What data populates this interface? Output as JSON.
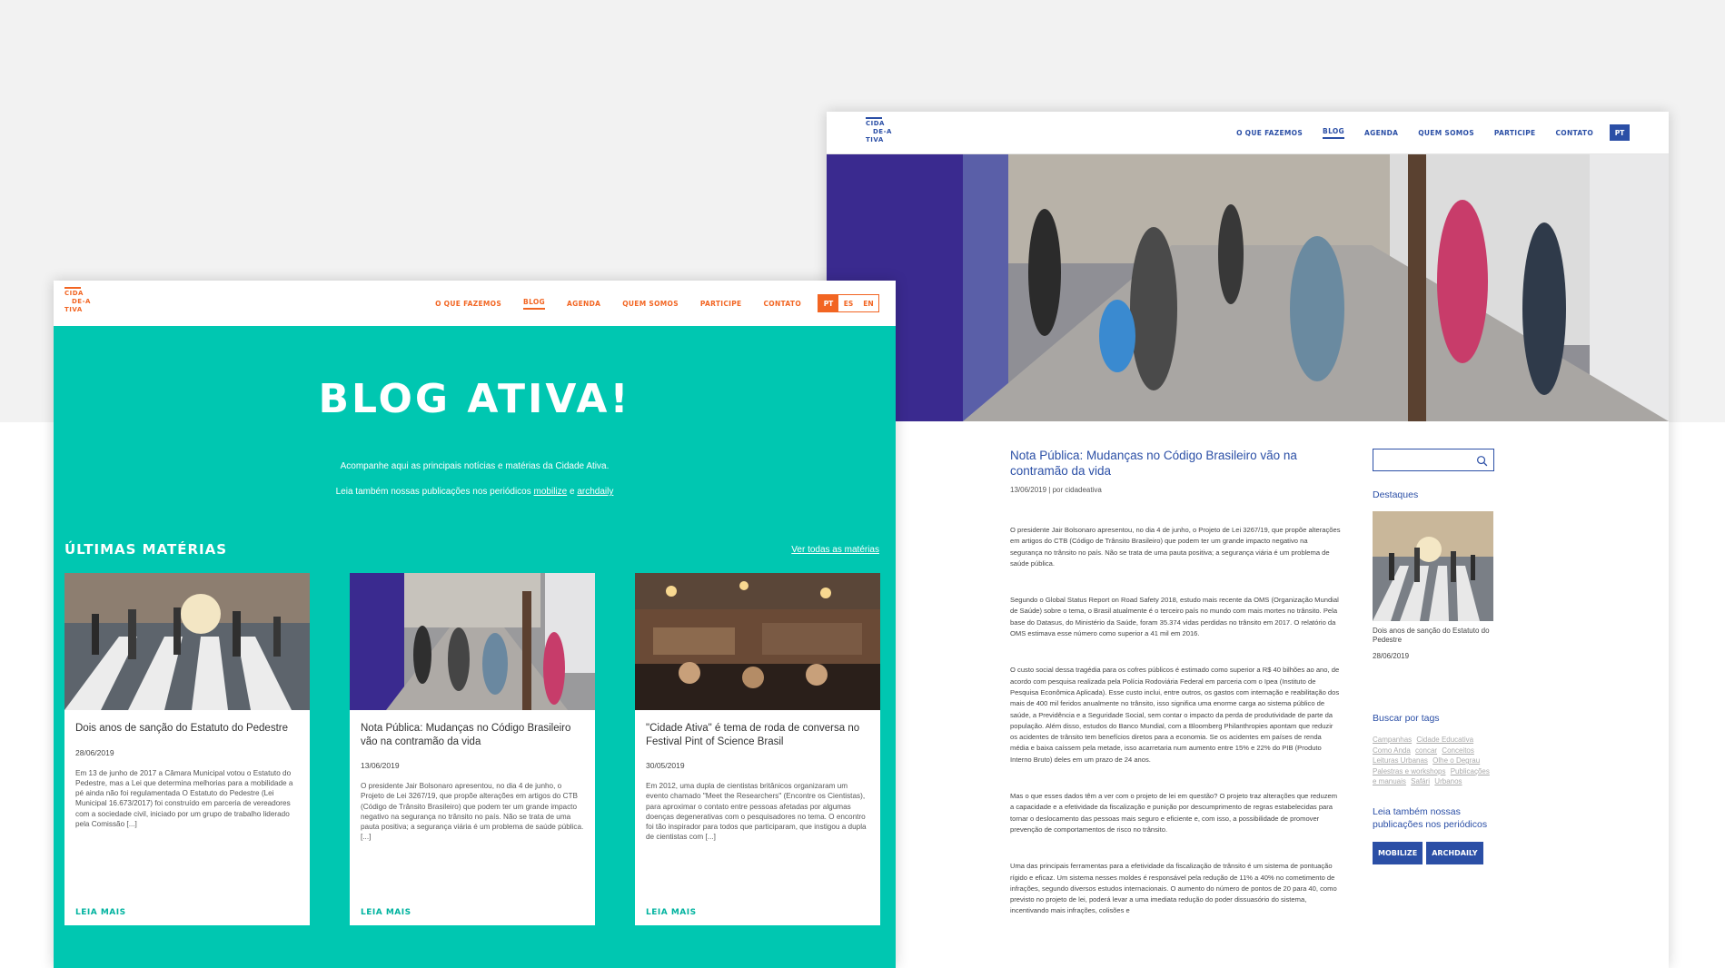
{
  "article_page": {
    "logo": [
      "CIDA",
      "DE-A",
      "TIVA"
    ],
    "nav": [
      "O QUE FAZEMOS",
      "BLOG",
      "AGENDA",
      "QUEM SOMOS",
      "PARTICIPE",
      "CONTATO"
    ],
    "lang": "PT",
    "article": {
      "title": "Nota Pública: Mudanças no Código Brasileiro vão na contramão da vida",
      "meta": "13/06/2019 | por cidadeativa",
      "paragraphs": [
        "O presidente Jair Bolsonaro apresentou, no dia 4 de junho, o Projeto de Lei 3267/19, que propõe alterações em artigos do CTB (Código de Trânsito Brasileiro) que podem ter um grande impacto negativo na segurança no trânsito no país. Não se trata de uma pauta positiva; a segurança viária é um problema de saúde pública.",
        "Segundo o Global Status Report on Road Safety 2018, estudo mais recente da OMS (Organização Mundial de Saúde) sobre o tema, o Brasil atualmente é o terceiro país no mundo com mais mortes no trânsito. Pela base do Datasus, do Ministério da Saúde, foram 35.374 vidas perdidas no trânsito em 2017. O relatório da OMS estimava esse número como superior a 41 mil em 2016.",
        "O custo social dessa tragédia para os cofres públicos é estimado como superior a R$ 40 bilhões ao ano, de acordo com pesquisa realizada pela Polícia Rodoviária Federal em parceria com o Ipea (Instituto de Pesquisa Econômica Aplicada). Esse custo inclui, entre outros, os gastos com internação e reabilitação dos mais de 400 mil feridos anualmente no trânsito, isso significa uma enorme carga ao sistema público de saúde, a Previdência e a Seguridade Social, sem contar o impacto da perda de produtividade de parte da população. Além disso, estudos do Banco Mundial, com a Bloomberg Philanthropies apontam que reduzir os acidentes de trânsito tem benefícios diretos para a economia. Se os acidentes em países de renda média e baixa caíssem pela metade, isso acarretaria num aumento entre 15% e 22% do PIB (Produto Interno Bruto) deles em um prazo de 24 anos.",
        "Mas o que esses dados têm a ver com o projeto de lei em questão? O projeto traz alterações que reduzem a capacidade e a efetividade da fiscalização e punição por descumprimento de regras estabelecidas para tornar o deslocamento das pessoas mais seguro e eficiente e, com isso, a possibilidade de promover prevenção de comportamentos de risco no trânsito.",
        "Uma das principais ferramentas para a efetividade da fiscalização de trânsito é um sistema de pontuação rígido e eficaz. Um sistema nesses moldes é responsável pela redução de 11% a 40% no cometimento de infrações, segundo diversos estudos internacionais. O aumento do número de pontos de 20 para 40, como previsto no projeto de lei, poderá levar a uma imediata redução do poder dissuasório do sistema, incentivando mais infrações, colisões e"
      ]
    },
    "sidebar": {
      "highlights_heading": "Destaques",
      "highlight_caption": "Dois anos de sanção do Estatuto do Pedestre",
      "highlight_date": "28/06/2019",
      "tags_heading": "Buscar por tags",
      "tags": [
        "Campanhas",
        "Cidade Educativa",
        "Como Anda",
        "concar",
        "Conceitos",
        "Leituras Urbanas",
        "Olhe o Degrau",
        "Palestras e workshops",
        "Publicações e manuais",
        "Safári",
        "Urbanos"
      ],
      "also_heading": "Leia também nossas publicações nos periódicos",
      "buttons": [
        "MOBILIZE",
        "ARCHDAILY"
      ]
    }
  },
  "blog_page": {
    "logo": [
      "CIDA",
      "DE-A",
      "TIVA"
    ],
    "nav": [
      "O QUE FAZEMOS",
      "BLOG",
      "AGENDA",
      "QUEM SOMOS",
      "PARTICIPE",
      "CONTATO"
    ],
    "langs": [
      "PT",
      "ES",
      "EN"
    ],
    "title": "BLOG ATIVA!",
    "intro_line1": "Acompanhe aqui as principais notícias e matérias da Cidade Ativa.",
    "intro_line2_prefix": "Leia também nossas publicações nos periódicos",
    "intro_link1": "mobilize",
    "intro_and": "e",
    "intro_link2": "archdaily",
    "section_title": "ÚLTIMAS MATÉRIAS",
    "see_all": "Ver todas as matérias",
    "read_more": "LEIA MAIS",
    "cards": [
      {
        "title": "Dois anos de sanção do Estatuto do Pedestre",
        "date": "28/06/2019",
        "excerpt": "Em 13 de junho de 2017 a Câmara Municipal votou o Estatuto do Pedestre, mas a Lei que determina melhorias para a mobilidade a pé ainda não foi regulamentada O Estatuto do Pedestre (Lei Municipal 16.673/2017) foi construído em parceria de vereadores com a sociedade civil, iniciado por um grupo de trabalho liderado pela Comissão [...]"
      },
      {
        "title": "Nota Pública: Mudanças no Código Brasileiro vão na contramão da vida",
        "date": "13/06/2019",
        "excerpt": "O presidente Jair Bolsonaro apresentou, no dia 4 de junho, o Projeto de Lei 3267/19, que propõe alterações em artigos do CTB (Código de Trânsito Brasileiro) que podem ter um grande impacto negativo na segurança no trânsito no país. Não se trata de uma pauta positiva; a segurança viária é um problema de saúde pública. [...]"
      },
      {
        "title": "\"Cidade Ativa\" é tema de roda de conversa no Festival Pint of Science Brasil",
        "date": "30/05/2019",
        "excerpt": "Em 2012, uma dupla de cientistas britânicos organizaram um evento chamado \"Meet the Researchers\" (Encontre os Cientistas), para aproximar o contato entre pessoas afetadas por algumas doenças degenerativas com o pesquisadores no tema. O encontro foi tão inspirador para todos que participaram, que instigou a dupla de cientistas com [...]"
      }
    ]
  },
  "colors": {
    "teal": "#00c7b1",
    "orange": "#f26522",
    "blue": "#2b4fa6",
    "bg_gray": "#f2f2f2"
  }
}
